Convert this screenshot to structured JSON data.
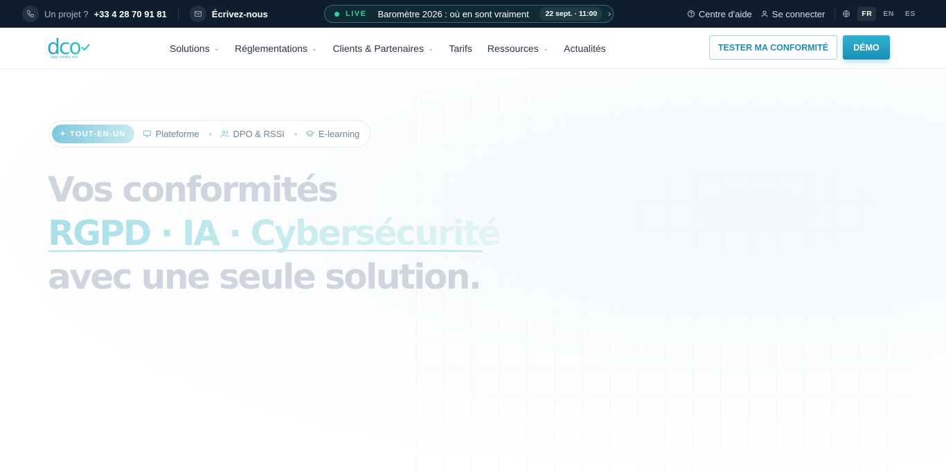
{
  "topbar": {
    "project_label": "Un projet ?",
    "phone": "+33 4 28 70 91 81",
    "write_us": "Écrivez-nous",
    "live_label": "LIVE",
    "live_text": "Baromètre 2026 : où en sont vraiment",
    "live_date": "22 sept. · 11:00",
    "help": "Centre d'aide",
    "login": "Se connecter",
    "languages": [
      "FR",
      "EN",
      "ES"
    ],
    "active_language": "FR"
  },
  "logo": {
    "letters": "dco",
    "tagline": "data comply one"
  },
  "nav": {
    "items": [
      "Solutions",
      "Réglementations",
      "Clients & Partenaires",
      "Tarifs",
      "Ressources",
      "Actualités"
    ],
    "cta_outline": "TESTER MA CONFORMITÉ",
    "cta_fill": "DÉMO"
  },
  "hero": {
    "pills": {
      "active": "TOUT-EN-UN",
      "items": [
        "Plateforme",
        "DPO & RSSI",
        "E-learning"
      ]
    },
    "title_line1": "Vos conformités",
    "title_line2": "RGPD · IA · Cybersécurité",
    "title_line3": "avec une seule solution."
  },
  "colors": {
    "topbar_bg": "#0f1e2e",
    "accent": "#1a8fb7",
    "live_green": "#2fd39a"
  }
}
